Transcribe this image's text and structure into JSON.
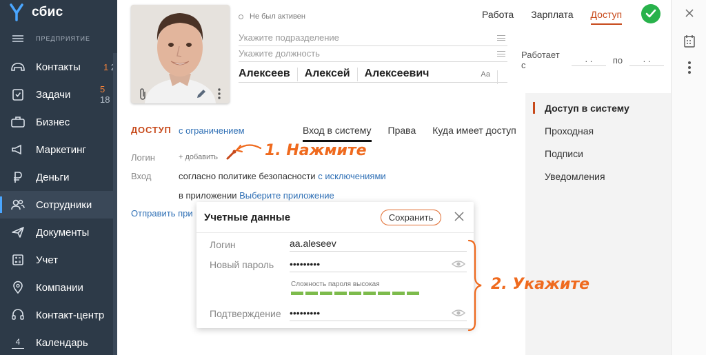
{
  "app": {
    "logo_text": "сбис",
    "subtitle": "ПРЕДПРИЯТИЕ"
  },
  "sidebar": {
    "items": [
      {
        "label": "Контакты",
        "icon": "contacts-icon",
        "count_orange": "1",
        "count_gray": "2"
      },
      {
        "label": "Задачи",
        "icon": "tasks-icon",
        "count_orange": "5",
        "count_gray": "18"
      },
      {
        "label": "Бизнес",
        "icon": "business-icon"
      },
      {
        "label": "Маркетинг",
        "icon": "megaphone-icon"
      },
      {
        "label": "Деньги",
        "icon": "ruble-icon"
      },
      {
        "label": "Сотрудники",
        "icon": "employees-icon"
      },
      {
        "label": "Документы",
        "icon": "paper-plane-icon"
      },
      {
        "label": "Учет",
        "icon": "accounting-icon"
      },
      {
        "label": "Компании",
        "icon": "location-pin-icon"
      },
      {
        "label": "Контакт-центр",
        "icon": "headset-icon"
      },
      {
        "label": "Календарь",
        "icon": "calendar-icon",
        "icon_text": "4"
      }
    ]
  },
  "employee": {
    "status": "Не был активен",
    "department_placeholder": "Укажите подразделение",
    "position_placeholder": "Укажите должность",
    "last_name": "Алексеев",
    "first_name": "Алексей",
    "middle_name": "Алексеевич",
    "font_toggle": "Аа"
  },
  "top_tabs": [
    {
      "label": "Работа"
    },
    {
      "label": "Зарплата"
    },
    {
      "label": "Доступ",
      "active": true
    }
  ],
  "works": {
    "label": "Работает с",
    "from": ". .",
    "to_label": "по",
    "to": ". ."
  },
  "access": {
    "heading": "ДОСТУП",
    "mode": "с ограничением",
    "tabs": [
      {
        "label": "Вход в систему",
        "active": true
      },
      {
        "label": "Права"
      },
      {
        "label": "Куда имеет доступ"
      }
    ],
    "login_label": "Логин",
    "add_label": "+ добавить",
    "entry_label": "Вход",
    "entry_value": "согласно политике безопасности",
    "entry_link": "с исключениями",
    "app_prefix": "в приложении",
    "app_link": "Выберите приложение",
    "send_link": "Отправить при"
  },
  "right_nav": [
    {
      "label": "Доступ в систему",
      "active": true
    },
    {
      "label": "Проходная"
    },
    {
      "label": "Подписи"
    },
    {
      "label": "Уведомления"
    }
  ],
  "dialog": {
    "title": "Учетные данные",
    "save_label": "Сохранить",
    "login_label": "Логин",
    "login_value": "aa.aleseev",
    "password_label": "Новый пароль",
    "password_value": "•••••••••",
    "strength_text": "Сложность пароля высокая",
    "strength_level": 9,
    "strength_total": 9,
    "confirm_label": "Подтверждение",
    "confirm_value": "•••••••••"
  },
  "annotations": {
    "step1": "1. Нажмите",
    "step2": "2. Укажите"
  },
  "colors": {
    "accent": "#c7491a",
    "link": "#2e6fb5",
    "annotation": "#ef6a1e",
    "success": "#28b24b",
    "sidebar": "#2d3a48"
  }
}
